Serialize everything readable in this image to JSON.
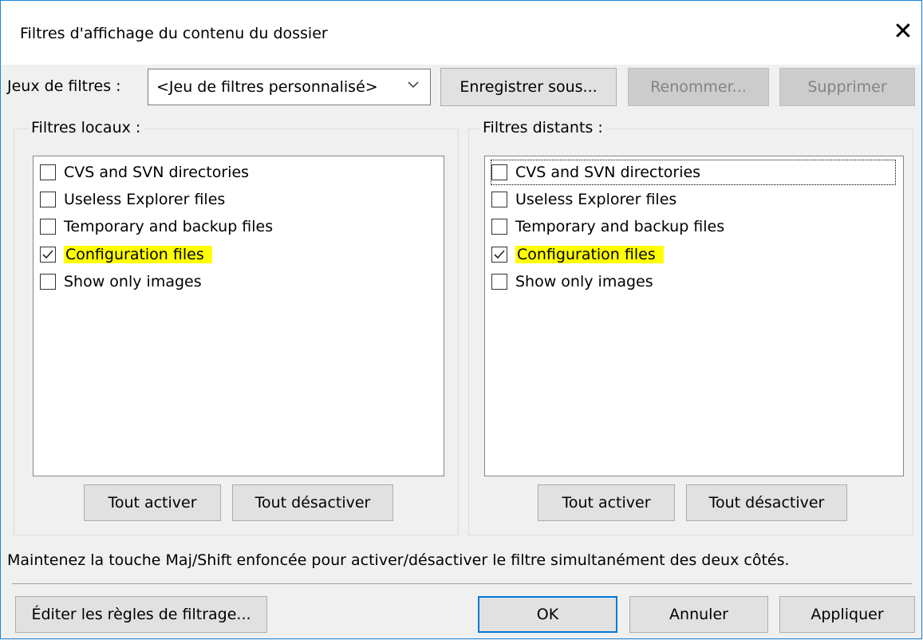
{
  "title": "Filtres d'affichage du contenu du dossier",
  "close_glyph": "✕",
  "filter_sets": {
    "label": "Jeux de filtres :",
    "selected": "<Jeu de filtres personnalisé>",
    "save_as": "Enregistrer sous...",
    "rename": "Renommer...",
    "delete": "Supprimer"
  },
  "local": {
    "legend": "Filtres locaux :",
    "items": [
      {
        "label": "CVS and SVN directories",
        "checked": false
      },
      {
        "label": "Useless Explorer files",
        "checked": false
      },
      {
        "label": "Temporary and backup files",
        "checked": false
      },
      {
        "label": "Configuration files",
        "checked": true
      },
      {
        "label": "Show only images",
        "checked": false
      }
    ],
    "enable_all": "Tout activer",
    "disable_all": "Tout désactiver"
  },
  "remote": {
    "legend": "Filtres distants :",
    "items": [
      {
        "label": "CVS and SVN directories",
        "checked": false
      },
      {
        "label": "Useless Explorer files",
        "checked": false
      },
      {
        "label": "Temporary and backup files",
        "checked": false
      },
      {
        "label": "Configuration files",
        "checked": true
      },
      {
        "label": "Show only images",
        "checked": false
      }
    ],
    "enable_all": "Tout activer",
    "disable_all": "Tout désactiver"
  },
  "hint": "Maintenez la touche Maj/Shift enfoncée pour activer/désactiver le filtre simultanément des deux côtés.",
  "footer": {
    "edit_rules": "Éditer les règles de filtrage...",
    "ok": "OK",
    "cancel": "Annuler",
    "apply": "Appliquer"
  },
  "colors": {
    "highlight": "#ffff00",
    "default_button_border": "#0078d7",
    "window_border": "#1883d7"
  },
  "icons": {
    "close": "close-icon",
    "dropdown": "chevron-down-icon",
    "check": "checkmark-icon"
  }
}
